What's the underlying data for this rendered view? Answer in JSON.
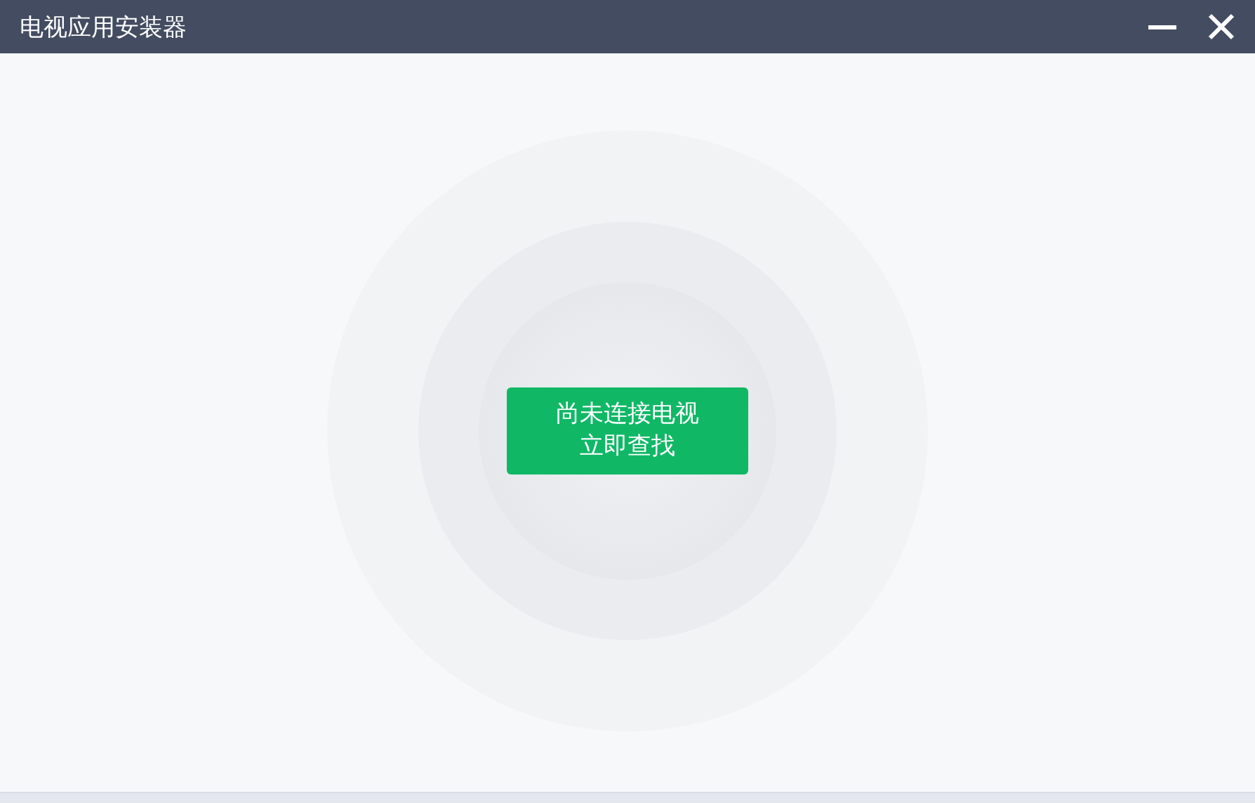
{
  "window": {
    "title": "电视应用安装器"
  },
  "search_button": {
    "lines": [
      "尚未连接电视",
      "立即查找"
    ]
  }
}
